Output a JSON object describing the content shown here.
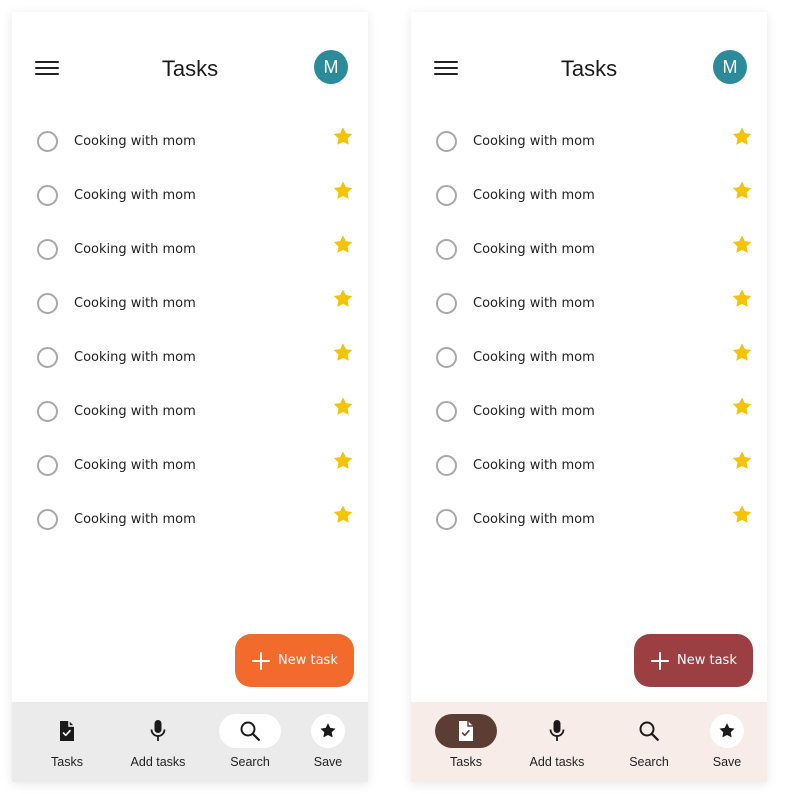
{
  "colors": {
    "star": "#F5C400",
    "avatar_bg": "#2C8B9A",
    "theme_a": {
      "fab": "#F26B2C",
      "nav_bg": "#EBEBEB",
      "selected_pill": "#FFFFFF"
    },
    "theme_b": {
      "fab": "#9B3F43",
      "nav_bg": "#F8ECE8",
      "selected_pill": "#5C3D34"
    }
  },
  "screens": [
    {
      "title": "Tasks",
      "avatar_initial": "M",
      "tasks": [
        {
          "label": "Cooking with mom",
          "starred": true,
          "done": false
        },
        {
          "label": "Cooking with mom",
          "starred": true,
          "done": false
        },
        {
          "label": "Cooking with mom",
          "starred": true,
          "done": false
        },
        {
          "label": "Cooking with mom",
          "starred": true,
          "done": false
        },
        {
          "label": "Cooking with mom",
          "starred": true,
          "done": false
        },
        {
          "label": "Cooking with mom",
          "starred": true,
          "done": false
        },
        {
          "label": "Cooking with mom",
          "starred": true,
          "done": false
        },
        {
          "label": "Cooking with mom",
          "starred": true,
          "done": false
        }
      ],
      "fab_label": "New task",
      "fab_icon": "plus-icon",
      "nav": [
        {
          "label": "Tasks",
          "icon": "task-document-icon",
          "selected": false
        },
        {
          "label": "Add tasks",
          "icon": "microphone-icon",
          "selected": false
        },
        {
          "label": "Search",
          "icon": "search-icon",
          "selected": true
        },
        {
          "label": "Save",
          "icon": "star-icon",
          "selected": false
        }
      ]
    },
    {
      "title": "Tasks",
      "avatar_initial": "M",
      "tasks": [
        {
          "label": "Cooking with mom",
          "starred": true,
          "done": false
        },
        {
          "label": "Cooking with mom",
          "starred": true,
          "done": false
        },
        {
          "label": "Cooking with mom",
          "starred": true,
          "done": false
        },
        {
          "label": "Cooking with mom",
          "starred": true,
          "done": false
        },
        {
          "label": "Cooking with mom",
          "starred": true,
          "done": false
        },
        {
          "label": "Cooking with mom",
          "starred": true,
          "done": false
        },
        {
          "label": "Cooking with mom",
          "starred": true,
          "done": false
        },
        {
          "label": "Cooking with mom",
          "starred": true,
          "done": false
        }
      ],
      "fab_label": "New task",
      "fab_icon": "plus-icon",
      "nav": [
        {
          "label": "Tasks",
          "icon": "task-document-icon",
          "selected": true
        },
        {
          "label": "Add tasks",
          "icon": "microphone-icon",
          "selected": false
        },
        {
          "label": "Search",
          "icon": "search-icon",
          "selected": false
        },
        {
          "label": "Save",
          "icon": "star-icon",
          "selected": false
        }
      ]
    }
  ]
}
